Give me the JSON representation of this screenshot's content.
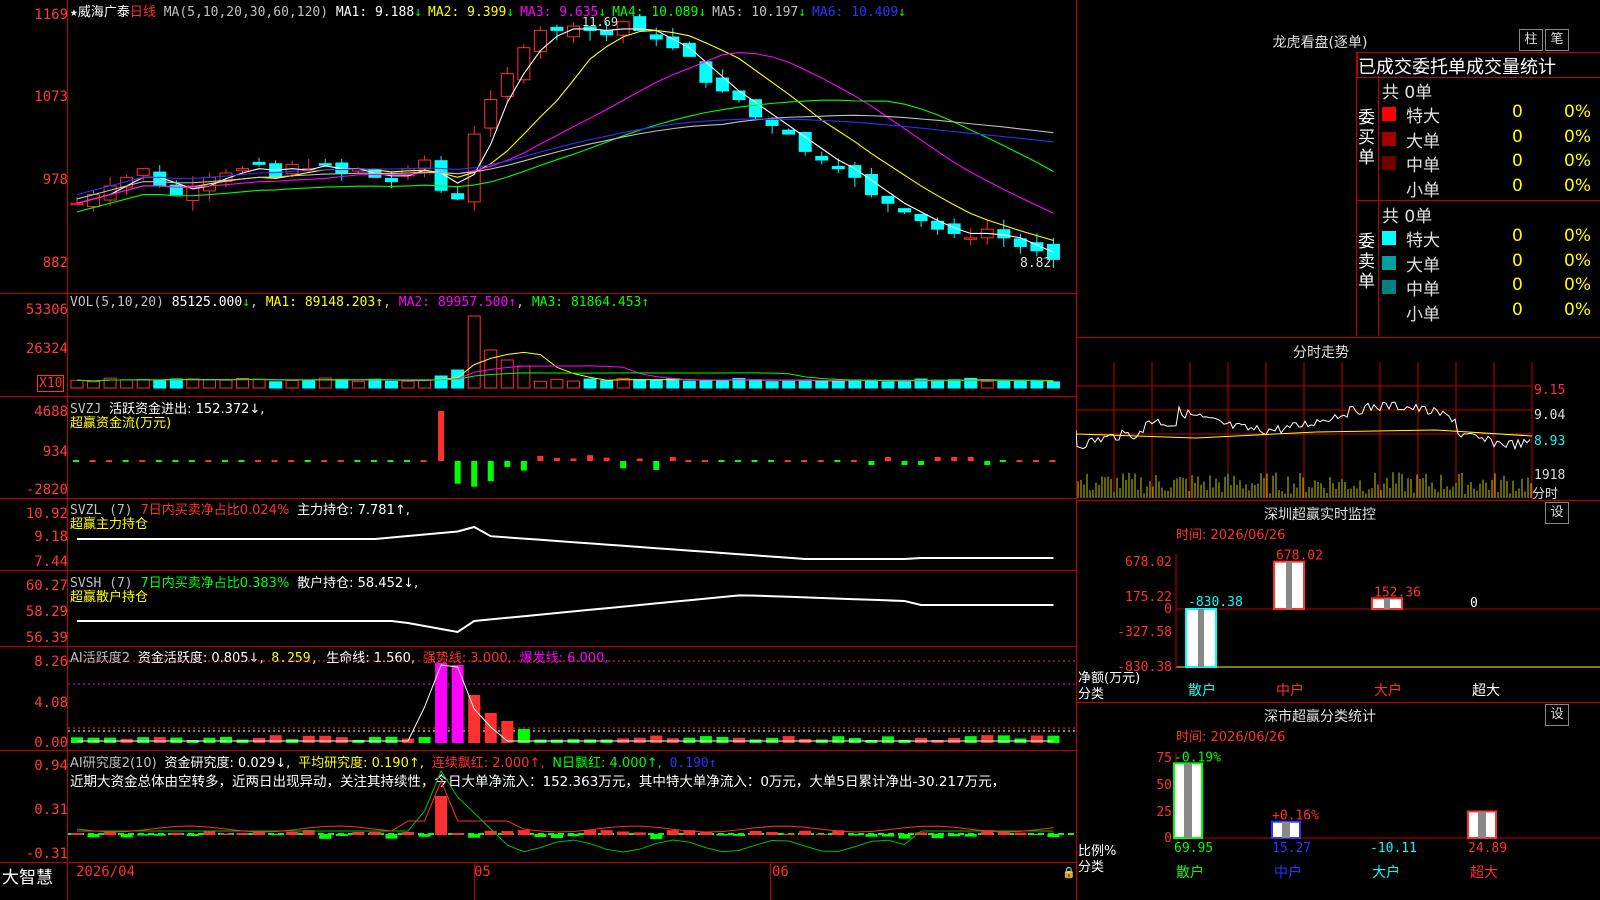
{
  "stock": {
    "star": "★",
    "name": "威海广泰",
    "period": "日线"
  },
  "colors": {
    "red": "#ff3030",
    "cyan": "#00ffff",
    "yellow": "#ffff00",
    "magenta": "#ff00ff",
    "green": "#00ff00",
    "blue": "#0000ff",
    "white": "#ffffff",
    "grid": "#c00000"
  },
  "main_panel": {
    "ma_label": "MA(5,10,20,30,60,120)",
    "ma": [
      {
        "name": "MA1:",
        "value": "9.188",
        "arrow": "↓",
        "color": "#ffffff"
      },
      {
        "name": "MA2:",
        "value": "9.399",
        "arrow": "↓",
        "color": "#ffff00"
      },
      {
        "name": "MA3:",
        "value": "9.635",
        "arrow": "↓",
        "color": "#ff00ff"
      },
      {
        "name": "MA4:",
        "value": "10.089",
        "arrow": "↓",
        "color": "#00ff00"
      },
      {
        "name": "MA5:",
        "value": "10.197",
        "arrow": "↓",
        "color": "#c0c0c0"
      },
      {
        "name": "MA6:",
        "value": "10.409",
        "arrow": "↓",
        "color": "#3030ff"
      }
    ],
    "y_labels": [
      "1169",
      "1073",
      "978",
      "882"
    ],
    "high_mark": "11.69",
    "low_mark": "8.82"
  },
  "vol_panel": {
    "label": "VOL(5,10,20)",
    "value": "85125.000",
    "arrow": "↓",
    "ma1": "MA1: 89148.203↑",
    "ma2": "MA2: 89957.500↑",
    "ma3": "MA3: 81864.453↑",
    "y_labels": [
      "53306",
      "26324"
    ],
    "unit": "X10"
  },
  "svzj_panel": {
    "label": "SVZJ",
    "text": "活跃资金进出: 152.372↓,",
    "sub": "超赢资金流(万元)",
    "y_labels": [
      "4688",
      "934",
      "-2820"
    ]
  },
  "svzl_panel": {
    "label": "SVZL (7)",
    "t1": "7日内买卖净占比0.024%",
    "t2": "主力持仓: 7.781↑,",
    "sub": "超赢主力持仓",
    "y_labels": [
      "10.92",
      "9.18",
      "7.44"
    ]
  },
  "svsh_panel": {
    "label": "SVSH (7)",
    "t1": "7日内买卖净占比0.383%",
    "t2": "散户持仓: 58.452↓,",
    "sub": "超赢散户持仓",
    "y_labels": [
      "60.27",
      "58.29",
      "56.39"
    ]
  },
  "ai_active_panel": {
    "label": "AI活跃度2",
    "t1": "资金活跃度: 0.805↓,",
    "t2": "8.259,",
    "t3": "生命线: 1.560,",
    "t4": "强势线: 3.000,",
    "t5": "爆发线: 6.000,",
    "y_labels": [
      "8.26",
      "4.08",
      "0.00"
    ]
  },
  "ai_research_panel": {
    "label": "AI研究度2(10)",
    "t1": "资金研究度: 0.029↓,",
    "t2": "平均研究度: 0.190↑,",
    "t3": "连续飘红: 2.000↑,",
    "t4": "N日飘红: 4.000↑,",
    "t5": "0.190↑",
    "comment": "近期大资金总体由空转多，近两日出现异动，关注其持续性，今日大单净流入：152.363万元，其中特大单净流入：0万元，大单5日累计净出-30.217万元，",
    "y_labels": [
      "0.94",
      "0.31",
      "-0.31"
    ]
  },
  "bottom_axis": {
    "logo": "大智慧",
    "d1": "2026/04",
    "d2": "05",
    "d3": "06"
  },
  "right_panel": {
    "title": "龙虎看盘(逐单)",
    "btn1": "柱",
    "btn2": "笔",
    "header": "已成交委托单成交量统计",
    "buy_label": "委买单",
    "sell_label": "委卖单",
    "buy_total": "共 0单",
    "sell_total": "共 0单",
    "buy_rows": [
      {
        "label": "特大",
        "v": "0",
        "p": "0%",
        "color": "#ff0000"
      },
      {
        "label": "大单",
        "v": "0",
        "p": "0%",
        "color": "#a00000"
      },
      {
        "label": "中单",
        "v": "0",
        "p": "0%",
        "color": "#700000"
      },
      {
        "label": "小单",
        "v": "0",
        "p": "0%",
        "color": ""
      }
    ],
    "sell_rows": [
      {
        "label": "特大",
        "v": "0",
        "p": "0%",
        "color": "#00ffff"
      },
      {
        "label": "大单",
        "v": "0",
        "p": "0%",
        "color": "#00a0a0"
      },
      {
        "label": "中单",
        "v": "0",
        "p": "0%",
        "color": "#008080"
      },
      {
        "label": "小单",
        "v": "0",
        "p": "0%",
        "color": ""
      }
    ],
    "intraday_title": "分时走势",
    "intraday_labels": [
      "9.15",
      "9.04",
      "8.93",
      "1918",
      "分时"
    ],
    "sz_title": "深圳超赢实时监控",
    "sz_btn": "设",
    "sz_time": "时间: 2026/06/26",
    "sz_y": [
      "678.02",
      "175.22",
      "0",
      "-327.58",
      "-830.38"
    ],
    "sz_bars": [
      {
        "label": "-830.38",
        "value": -830.38
      },
      {
        "label": "678.02",
        "value": 678.02
      },
      {
        "label": "152.36",
        "value": 152.36
      },
      {
        "label": "0",
        "value": 0
      }
    ],
    "sz_axis_title": "净额(万元)",
    "sz_cat_title": "分类",
    "sz_cats": [
      "散户",
      "中户",
      "大户",
      "超大"
    ],
    "cls_title": "深市超赢分类统计",
    "cls_btn": "设",
    "cls_time": "时间: 2026/06/26",
    "cls_y": [
      "75",
      "50",
      "25",
      "0"
    ],
    "cls_bars": [
      {
        "top": "-0.19%",
        "value": 69.95,
        "bottom": "69.95"
      },
      {
        "top": "+0.16%",
        "value": 15.27,
        "bottom": "15.27"
      },
      {
        "top": "",
        "value": 0,
        "bottom": "-10.11"
      },
      {
        "top": "",
        "value": 24.89,
        "bottom": "24.89"
      }
    ],
    "cls_axis_title": "比例%",
    "cls_cat_title": "分类",
    "cls_cats": [
      "散户",
      "中户",
      "大户",
      "超大"
    ]
  }
}
